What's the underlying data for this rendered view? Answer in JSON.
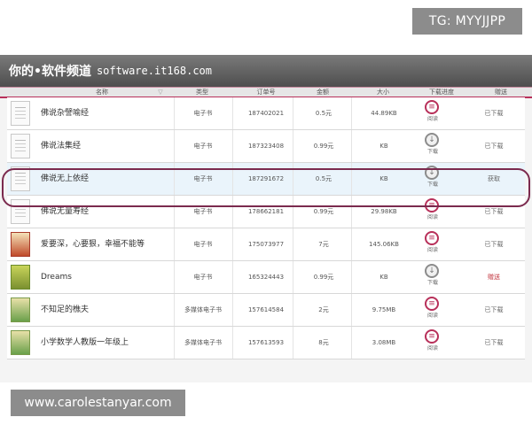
{
  "overlay": {
    "tg_label": "TG: MYYJJPP",
    "watermark_text": "www.carolestanyar.com"
  },
  "banner": {
    "title": "你的•软件频道",
    "site": "software.it168.com"
  },
  "columns": {
    "name": "名称",
    "type": "类型",
    "order_no": "订单号",
    "amount": "金额",
    "size": "大小",
    "progress": "下载进度",
    "action": "赠送"
  },
  "rows": [
    {
      "name": "佛说杂譬喻经",
      "type": "电子书",
      "order_no": "187402021",
      "amount": "0.5元",
      "size": "44.89KB",
      "icon": "book-icon",
      "progress_label": "阅读",
      "status": "已下载",
      "thumb": "page"
    },
    {
      "name": "佛说法集经",
      "type": "电子书",
      "order_no": "187323408",
      "amount": "0.99元",
      "size": "KB",
      "icon": "download-icon",
      "progress_label": "下载",
      "status": "已下载",
      "thumb": "page"
    },
    {
      "name": "佛说无上依经",
      "type": "电子书",
      "order_no": "187291672",
      "amount": "0.5元",
      "size": "KB",
      "icon": "download-icon",
      "progress_label": "下载",
      "status": "获取",
      "thumb": "page"
    },
    {
      "name": "佛说无量寿经",
      "type": "电子书",
      "order_no": "178662181",
      "amount": "0.99元",
      "size": "29.98KB",
      "icon": "book-icon",
      "progress_label": "阅读",
      "status": "已下载",
      "thumb": "page"
    },
    {
      "name": "爱要深，心要狠，幸福不能等",
      "type": "电子书",
      "order_no": "175073977",
      "amount": "7元",
      "size": "145.06KB",
      "icon": "book-icon",
      "progress_label": "阅读",
      "status": "已下载",
      "thumb": "red"
    },
    {
      "name": "Dreams",
      "type": "电子书",
      "order_no": "165324443",
      "amount": "0.99元",
      "size": "KB",
      "icon": "download-icon",
      "progress_label": "下载",
      "status": "赠送",
      "thumb": "green"
    },
    {
      "name": "不知足的樵夫",
      "type": "多媒体电子书",
      "order_no": "157614584",
      "amount": "2元",
      "size": "9.75MB",
      "icon": "book-icon",
      "progress_label": "阅读",
      "status": "已下载",
      "thumb": "multi"
    },
    {
      "name": "小学数学人教版一年级上",
      "type": "多媒体电子书",
      "order_no": "157613593",
      "amount": "8元",
      "size": "3.08MB",
      "icon": "book-icon",
      "progress_label": "阅读",
      "status": "已下载",
      "thumb": "multi"
    }
  ],
  "colors": {
    "accent": "#b8305a",
    "highlight_ring": "#7b2a4e",
    "donate": "#c0303a"
  }
}
